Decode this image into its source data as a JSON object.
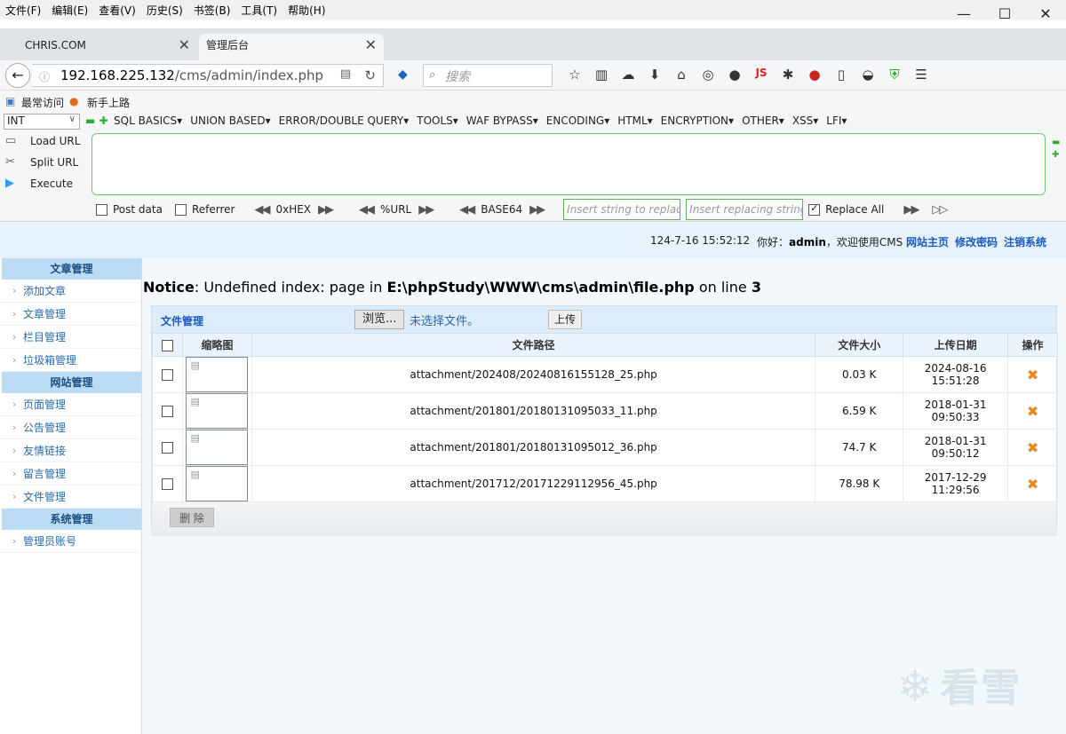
{
  "menubar": [
    "文件(F)",
    "编辑(E)",
    "查看(V)",
    "历史(S)",
    "书签(B)",
    "工具(T)",
    "帮助(H)"
  ],
  "window_controls": [
    "—",
    "☐",
    "✕"
  ],
  "tabs": [
    {
      "label": "CHRIS.COM"
    },
    {
      "label": "管理后台"
    }
  ],
  "url": {
    "host": "192.168.225.132",
    "path": "/cms/admin/index.php"
  },
  "search_placeholder": "搜索",
  "bookmarks": [
    "最常访问",
    "新手上路"
  ],
  "hackbar": {
    "select_value": "INT",
    "menus": [
      "SQL BASICS▾",
      "UNION BASED▾",
      "ERROR/DOUBLE QUERY▾",
      "TOOLS▾",
      "WAF BYPASS▾",
      "ENCODING▾",
      "HTML▾",
      "ENCRYPTION▾",
      "OTHER▾",
      "XSS▾",
      "LFI▾"
    ],
    "actions": [
      "Load URL",
      "Split URL",
      "Execute"
    ],
    "post_data": "Post data",
    "referrer": "Referrer",
    "hex": "0xHEX",
    "url_enc": "%URL",
    "base64": "BASE64",
    "insert_string_placeholder": "Insert string to replace",
    "insert_replacing_placeholder": "Insert replacing string",
    "replace_all": "Replace All"
  },
  "topline": {
    "time": "124-7-16 15:52:12",
    "greet_prefix": "你好：",
    "user": "admin",
    "greet_suffix": "，欢迎使用CMS",
    "links": [
      "网站主页",
      "修改密码",
      "注销系统"
    ]
  },
  "sidebar": [
    {
      "head": "文章管理",
      "items": [
        "添加文章",
        "文章管理",
        "栏目管理",
        "垃圾箱管理"
      ]
    },
    {
      "head": "网站管理",
      "items": [
        "页面管理",
        "公告管理",
        "友情链接",
        "留言管理",
        "文件管理"
      ]
    },
    {
      "head": "系统管理",
      "items": [
        "管理员账号"
      ]
    }
  ],
  "notice": {
    "label": "Notice",
    "text1": ": Undefined index: page in ",
    "file": "E:\\phpStudy\\WWW\\cms\\admin\\file.php",
    "text2": " on line ",
    "line": "3"
  },
  "filebox": {
    "title": "文件管理",
    "browse": "浏览...",
    "no_file": "未选择文件。",
    "upload": "上传",
    "columns": [
      "缩略图",
      "文件路径",
      "文件大小",
      "上传日期",
      "操作"
    ],
    "rows": [
      {
        "path": "attachment/202408/20240816155128_25.php",
        "size": "0.03 K",
        "date": "2024-08-16",
        "time": "15:51:28"
      },
      {
        "path": "attachment/201801/20180131095033_11.php",
        "size": "6.59 K",
        "date": "2018-01-31",
        "time": "09:50:33"
      },
      {
        "path": "attachment/201801/20180131095012_36.php",
        "size": "74.7 K",
        "date": "2018-01-31",
        "time": "09:50:12"
      },
      {
        "path": "attachment/201712/20171229112956_45.php",
        "size": "78.98 K",
        "date": "2017-12-29",
        "time": "11:29:56"
      }
    ],
    "delete": "删 除"
  },
  "watermark": "看雪"
}
